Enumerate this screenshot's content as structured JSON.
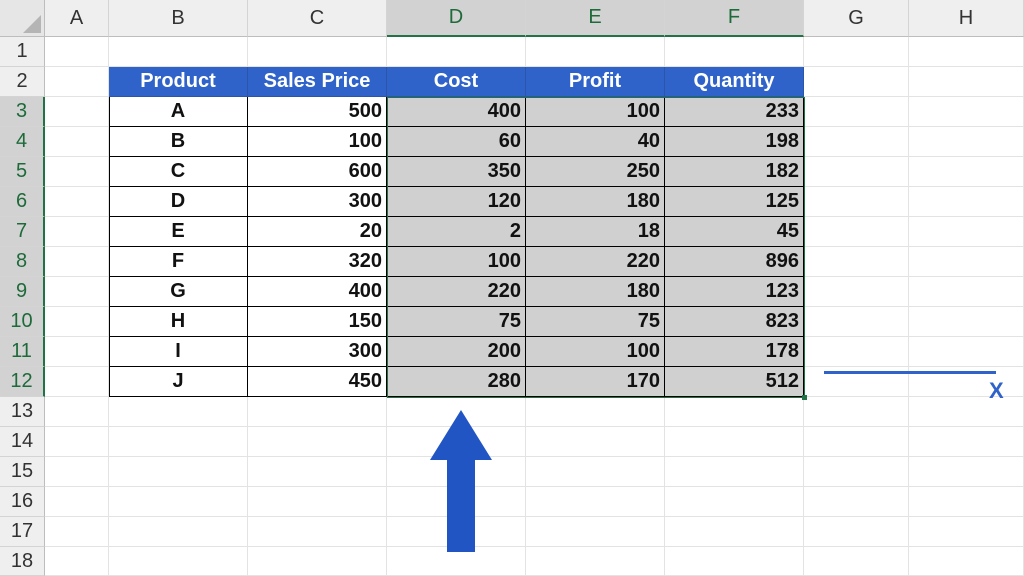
{
  "columns": [
    "A",
    "B",
    "C",
    "D",
    "E",
    "F",
    "G",
    "H"
  ],
  "rows": [
    "1",
    "2",
    "3",
    "4",
    "5",
    "6",
    "7",
    "8",
    "9",
    "10",
    "11",
    "12",
    "13",
    "14",
    "15",
    "16",
    "17",
    "18"
  ],
  "selected_columns": [
    "D",
    "E",
    "F"
  ],
  "selected_rows": [
    "3",
    "4",
    "5",
    "6",
    "7",
    "8",
    "9",
    "10",
    "11",
    "12"
  ],
  "table": {
    "headers": [
      "Product",
      "Sales Price",
      "Cost",
      "Profit",
      "Quantity"
    ],
    "rows": [
      [
        "A",
        "500",
        "400",
        "100",
        "233"
      ],
      [
        "B",
        "100",
        "60",
        "40",
        "198"
      ],
      [
        "C",
        "600",
        "350",
        "250",
        "182"
      ],
      [
        "D",
        "300",
        "120",
        "180",
        "125"
      ],
      [
        "E",
        "20",
        "2",
        "18",
        "45"
      ],
      [
        "F",
        "320",
        "100",
        "220",
        "896"
      ],
      [
        "G",
        "400",
        "220",
        "180",
        "123"
      ],
      [
        "H",
        "150",
        "75",
        "75",
        "823"
      ],
      [
        "I",
        "300",
        "200",
        "100",
        "178"
      ],
      [
        "J",
        "450",
        "280",
        "170",
        "512"
      ]
    ]
  },
  "annotation": {
    "axis_label": "X"
  },
  "colors": {
    "header_fill": "#2f63c9",
    "selection": "#217346",
    "arrow": "#2255c4"
  }
}
